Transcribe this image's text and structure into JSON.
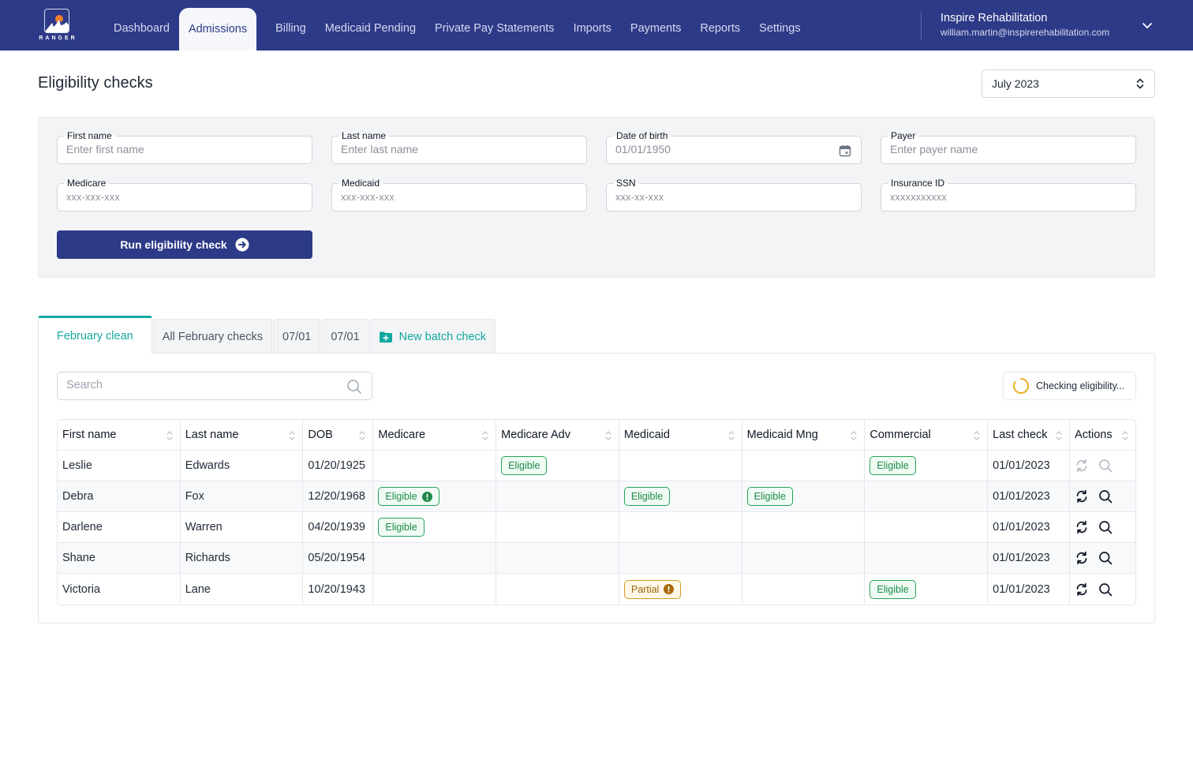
{
  "app": {
    "logo_text": "RANGER",
    "nav": [
      {
        "label": "Dashboard",
        "active": false
      },
      {
        "label": "Admissions",
        "active": true
      },
      {
        "label": "Billing",
        "active": false
      },
      {
        "label": "Medicaid Pending",
        "active": false
      },
      {
        "label": "Private Pay Statements",
        "active": false
      },
      {
        "label": "Imports",
        "active": false
      },
      {
        "label": "Payments",
        "active": false
      },
      {
        "label": "Reports",
        "active": false
      },
      {
        "label": "Settings",
        "active": false
      }
    ],
    "account": {
      "org_name": "Inspire Rehabilitation",
      "email": "william.martin@inspirerehabilitation.com",
      "menu_icon": "chevron-down-icon"
    },
    "brand_color": "#2d3a87",
    "accent_color": "#13a89e"
  },
  "page": {
    "title": "Eligibility checks",
    "month_select": {
      "value": "July 2023",
      "icon": "chevron-up-down-icon"
    }
  },
  "form": {
    "fields": [
      {
        "label": "First name",
        "placeholder": "Enter first name",
        "value": ""
      },
      {
        "label": "Last name",
        "placeholder": "Enter last name",
        "value": ""
      },
      {
        "label": "Date of birth",
        "placeholder": "01/01/1950",
        "value": "",
        "icon": "calendar-icon"
      },
      {
        "label": "Payer",
        "placeholder": "Enter payer name",
        "value": ""
      },
      {
        "label": "Medicare",
        "placeholder": "xxx-xxx-xxx",
        "value": ""
      },
      {
        "label": "Medicaid",
        "placeholder": "xxx-xxx-xxx",
        "value": ""
      },
      {
        "label": "SSN",
        "placeholder": "xxx-xx-xxx",
        "value": ""
      },
      {
        "label": "Insurance ID",
        "placeholder": "xxxxxxxxxxx",
        "value": ""
      }
    ],
    "submit_label": "Run eligibility check",
    "submit_icon": "arrow-right-circle-icon"
  },
  "tabs": [
    {
      "label": "February clean",
      "active": true
    },
    {
      "label": "All February checks",
      "active": false
    },
    {
      "label": "07/01",
      "active": false
    },
    {
      "label": "07/01",
      "active": false
    },
    {
      "label": "New batch check",
      "active": false,
      "icon": "folder-plus-icon"
    }
  ],
  "results": {
    "search_placeholder": "Search",
    "status_text": "Checking eligibility...",
    "status_color": "#e8b021",
    "columns": [
      "First name",
      "Last name",
      "DOB",
      "Medicare",
      "Medicare Adv",
      "Medicaid",
      "Medicaid Mng",
      "Commercial",
      "Last check",
      "Actions"
    ],
    "rows": [
      {
        "first": "Leslie",
        "last": "Edwards",
        "dob": "01/20/1925",
        "medicare": null,
        "medicare_adv": {
          "text": "Eligible",
          "type": "eligible",
          "alert": false
        },
        "medicaid": null,
        "medicaid_mng": null,
        "commercial": {
          "text": "Eligible",
          "type": "eligible",
          "alert": false
        },
        "last_check": "01/01/2023",
        "actions_disabled": true
      },
      {
        "first": "Debra",
        "last": "Fox",
        "dob": "12/20/1968",
        "medicare": {
          "text": "Eligible",
          "type": "eligible",
          "alert": true
        },
        "medicare_adv": null,
        "medicaid": {
          "text": "Eligible",
          "type": "eligible",
          "alert": false
        },
        "medicaid_mng": {
          "text": "Eligible",
          "type": "eligible",
          "alert": false
        },
        "commercial": null,
        "last_check": "01/01/2023",
        "actions_disabled": false
      },
      {
        "first": "Darlene",
        "last": "Warren",
        "dob": "04/20/1939",
        "medicare": {
          "text": "Eligible",
          "type": "eligible",
          "alert": false
        },
        "medicare_adv": null,
        "medicaid": null,
        "medicaid_mng": null,
        "commercial": null,
        "last_check": "01/01/2023",
        "actions_disabled": false
      },
      {
        "first": "Shane",
        "last": "Richards",
        "dob": "05/20/1954",
        "medicare": null,
        "medicare_adv": null,
        "medicaid": null,
        "medicaid_mng": null,
        "commercial": null,
        "last_check": "01/01/2023",
        "actions_disabled": false
      },
      {
        "first": "Victoria",
        "last": "Lane",
        "dob": "10/20/1943",
        "medicare": null,
        "medicare_adv": null,
        "medicaid": {
          "text": "Partial",
          "type": "partial",
          "alert": true
        },
        "medicaid_mng": null,
        "commercial": {
          "text": "Eligible",
          "type": "eligible",
          "alert": false
        },
        "last_check": "01/01/2023",
        "actions_disabled": false
      }
    ]
  }
}
